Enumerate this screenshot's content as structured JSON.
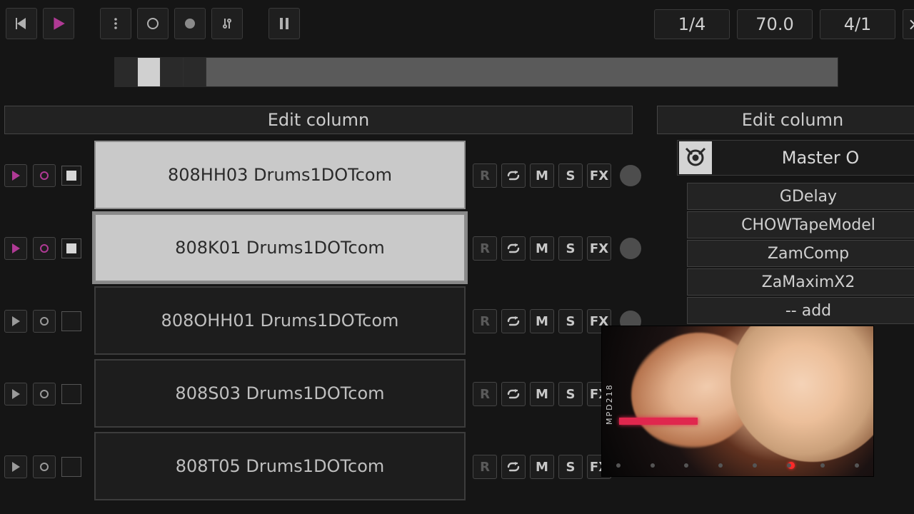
{
  "transport": {
    "beat_fraction": "1/4",
    "bpm": "70.0",
    "time_signature": "4/1"
  },
  "left_header": "Edit column",
  "right_header": "Edit column",
  "master_title": "Master O",
  "tracks": [
    {
      "name": "808HH03 Drums1DOTcom",
      "selected": true,
      "playing": true
    },
    {
      "name": "808K01 Drums1DOTcom",
      "selected": true,
      "playing": true
    },
    {
      "name": "808OHH01 Drums1DOTcom",
      "selected": false,
      "playing": false
    },
    {
      "name": "808S03 Drums1DOTcom",
      "selected": false,
      "playing": false
    },
    {
      "name": "808T05 Drums1DOTcom",
      "selected": false,
      "playing": false
    }
  ],
  "track_btns": {
    "R": "R",
    "M": "M",
    "S": "S",
    "FX": "FX"
  },
  "fx_chain": [
    "GDelay",
    "CHOWTapeModel",
    "ZamComp",
    "ZaMaximX2",
    "-- add"
  ],
  "overlay_device": "MPD218"
}
